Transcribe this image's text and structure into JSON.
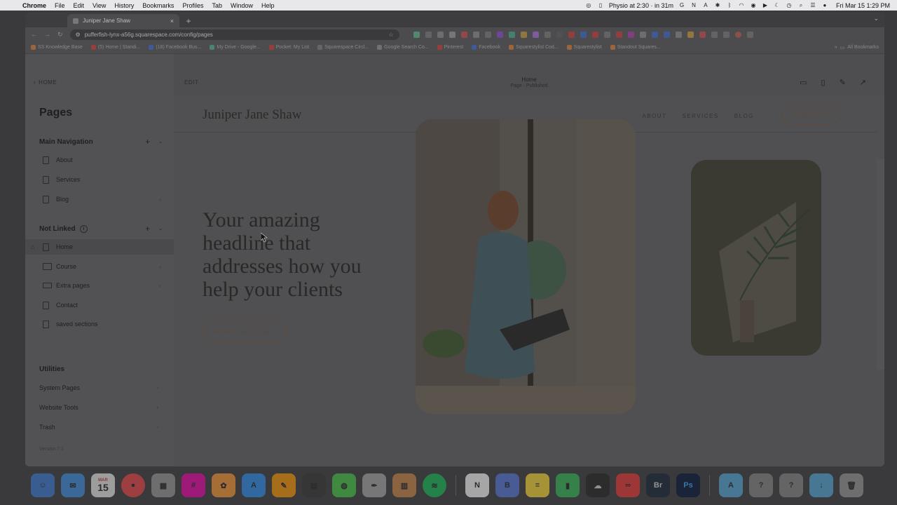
{
  "menubar": {
    "app": "Chrome",
    "items": [
      "File",
      "Edit",
      "View",
      "History",
      "Bookmarks",
      "Profiles",
      "Tab",
      "Window",
      "Help"
    ],
    "reminder": "Physio at 2:30 · in 31m",
    "datetime": "Fri Mar 15  1:29 PM"
  },
  "browser": {
    "tab_title": "Juniper Jane Shaw",
    "url": "pufferfish-lynx-a56g.squarespace.com/config/pages",
    "bookmarks": [
      "SS Knowledge Base",
      "(5) Home | Standi...",
      "(18) Facebook Bus...",
      "My Drive - Google...",
      "Pocket: My List",
      "Squarespace Circl...",
      "Google Search Co...",
      "Pinterest",
      "Facebook",
      "Squarestylist Cod...",
      "Squarestylist",
      "Standout Squares..."
    ],
    "all_bookmarks": "All Bookmarks"
  },
  "sidebar": {
    "home_label": "HOME",
    "title": "Pages",
    "main_nav_label": "Main Navigation",
    "main_nav_items": [
      "About",
      "Services",
      "Blog"
    ],
    "not_linked_label": "Not Linked",
    "not_linked_items": [
      "Home",
      "Course",
      "Extra pages",
      "Contact",
      "saved sections"
    ],
    "utilities_label": "Utilities",
    "utilities": [
      "System Pages",
      "Website Tools",
      "Trash"
    ],
    "version": "Version 7.1"
  },
  "editor": {
    "edit_label": "EDIT",
    "page_name": "Home",
    "page_status": "Page · Published"
  },
  "site": {
    "logo": "Juniper Jane Shaw",
    "nav": [
      "ABOUT",
      "SERVICES",
      "BLOG"
    ],
    "contact_button": "CONTACT",
    "headline": "Your amazing headline that addresses how you help your clients",
    "cta_button": "WORK WITH ME"
  },
  "dock": {
    "calendar_month": "MAR",
    "calendar_day": "15"
  }
}
